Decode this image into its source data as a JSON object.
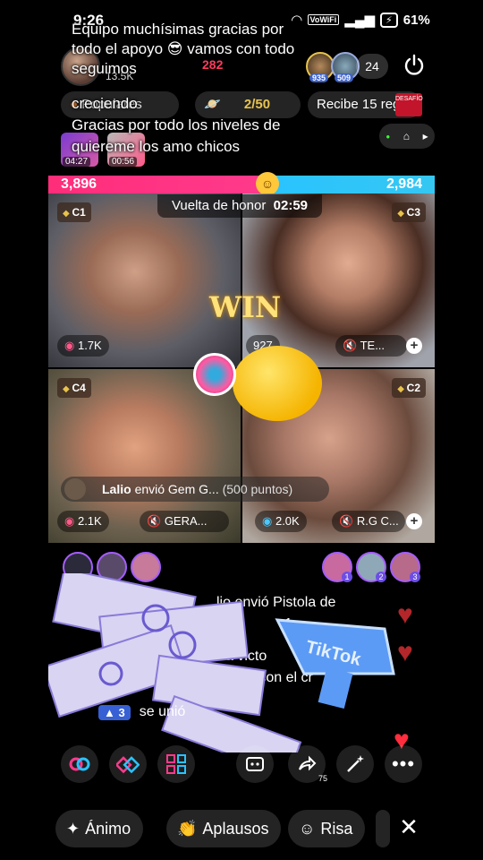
{
  "status": {
    "time": "9:26",
    "battery": "61%",
    "network": "VoWiFi"
  },
  "overlay": {
    "line1": "Equipo muchísimas gracias por todo el apoyo 😎 vamos con todo seguimos",
    "line2": "creciendo",
    "line3": "Gracias por todo los niveles de quiereme los amo chicos"
  },
  "host": {
    "likes": "13.5K",
    "badge_count": "282"
  },
  "top_viewers": [
    {
      "count": "935"
    },
    {
      "count": "509"
    }
  ],
  "viewer_count": "24",
  "pills": {
    "rank": "Populares",
    "goal_value": "2/50",
    "reward": "Recibe 15 reg",
    "desafio": "DESAFÍO"
  },
  "mini_lives": [
    "04:27",
    "00:56"
  ],
  "battle": {
    "left_score": "3,896",
    "right_score": "2,984",
    "honor_label": "Vuelta de honor",
    "timer": "02:59",
    "win_text": "WIN"
  },
  "cells": {
    "c1": {
      "tag": "C1",
      "likes": "1.7K"
    },
    "c3": {
      "tag": "C3",
      "likes": "927",
      "name": "TE..."
    },
    "c4": {
      "tag": "C4",
      "likes": "2.1K",
      "name": "GERA..."
    },
    "c2": {
      "tag": "C2",
      "likes": "2.0K",
      "name": "R.G C..."
    }
  },
  "gift_message": {
    "user": "Lalio",
    "text": "envió Gem G...",
    "points": "(500 puntos)"
  },
  "comments": [
    {
      "text": "lio envió Pistola de"
    },
    {
      "text": "1"
    },
    {
      "text": "a victo"
    },
    {
      "text": "honor con el cr"
    }
  ],
  "joined": {
    "level": "3",
    "text": "se unió"
  },
  "actions": {
    "share_count": "75"
  },
  "bottom": {
    "chip1": "Ánimo",
    "chip2": "Aplausos",
    "chip3": "Risa"
  },
  "colors": {
    "left_team": "#ff2d7a",
    "right_team": "#2ac3ff",
    "accent_gold": "#e7c34d"
  }
}
